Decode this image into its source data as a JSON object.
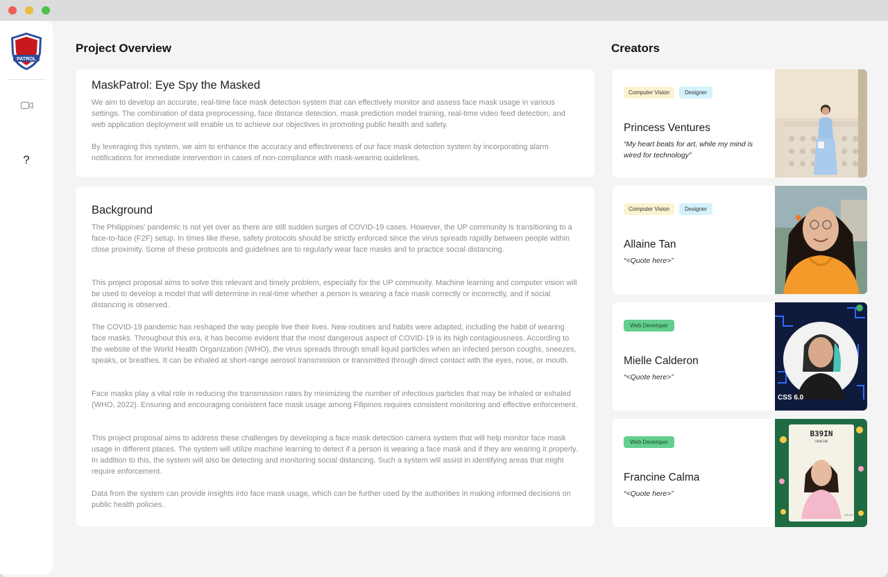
{
  "window": {
    "controls": [
      "close",
      "minimize",
      "maximize"
    ]
  },
  "sidebar": {
    "logo_text": "PATROL",
    "items": [
      {
        "icon": "video-camera-icon"
      },
      {
        "icon": "help-icon",
        "glyph": "?"
      }
    ]
  },
  "overview": {
    "heading": "Project Overview",
    "card": {
      "title": "MaskPatrol: Eye Spy the Masked",
      "paragraphs": [
        "We aim to develop an accurate, real-time face mask detection system that can effectively monitor and assess face mask usage in various settings. The combination of data preprocessing, face distance detection, mask prediction model training, real-time video feed detection, and web application deployment will enable us to achieve our objectives in promoting public health and safety.",
        "By leveraging this system, we aim to enhance the accuracy and effectiveness of our face mask detection system by incorporating alarm notifications for immediate intervention in cases of non-compliance with mask-wearing guidelines."
      ]
    }
  },
  "background": {
    "title": "Background",
    "paragraphs": [
      "The Philippines' pandemic is not yet over as there are still sudden surges of COVID-19 cases. However, the UP community is transitioning to a face-to-face (F2F) setup. In times like these, safety protocols should be strictly enforced since the virus spreads rapidly between people within close proximity. Some of these protocols and guidelines are to regularly wear face masks and to practice social distancing.",
      "This project proposal aims to solve this relevant and timely problem, especially for the UP community. Machine learning and computer vision will be used to develop a model that will determine in real-time whether a person is wearing a face mask correctly or incorrectly, and if social distancing is observed.",
      "The COVID-19 pandemic has reshaped the way people live their lives. New routines and habits were adapted, including the habit of wearing face masks. Throughout this era, it has become evident that the most dangerous aspect of COVID-19 is its high contagiousness. According to the website of the World Health Organization (WHO), the virus spreads through small liquid particles when an infected person coughs, sneezes, speaks, or breathes. It can be inhaled at short-range aerosol transmission or transmitted through direct contact with the eyes, nose, or mouth.",
      "Face masks play a vital role in reducing the transmission rates by minimizing the number of infectious particles that may be inhaled or exhaled (WHO, 2022). Ensuring and encouraging consistent face mask usage among Filipinos requires consistent monitoring and effective enforcement.",
      "This project proposal aims to address these challenges by developing a face mask detection camera system that will help monitor face mask usage in different places. The system will utilize machine learning to detect if a person is wearing a face mask and if they are wearing it properly. In addition to this, the system will also be detecting and monitoring social distancing.  Such a system will assist in identifying areas that might require enforcement.",
      "Data from the system can provide insights into face mask usage, which can be further used by the authorities in making informed decisions on public health policies."
    ]
  },
  "creators": {
    "heading": "Creators",
    "list": [
      {
        "name": "Princess Ventures",
        "quote": "“My heart beats for art, while my mind is wired for technology”",
        "tags": [
          "Computer Vision",
          "Designer"
        ]
      },
      {
        "name": "Allaine Tan",
        "quote": "“<Quote here>”",
        "tags": [
          "Computer Vision",
          "Designer"
        ]
      },
      {
        "name": "Mielle Calderon",
        "quote": "“<Quote here>”",
        "tags": [
          "Web Developer"
        ]
      },
      {
        "name": "Francine Calma",
        "quote": "“<Quote here>”",
        "tags": [
          "Web Developer"
        ],
        "photo_text": [
          "B39IN",
          "FRANCINE",
          "CS 6.0"
        ]
      }
    ],
    "photo_text": {
      "mielle": "CSS 6.0"
    }
  },
  "colors": {
    "tag_computer_vision": "#fbf2cf",
    "tag_designer": "#d3f2fb",
    "tag_web_developer": "#64cf8c",
    "logo_red": "#c8191e",
    "logo_blue": "#2c4c9c"
  }
}
